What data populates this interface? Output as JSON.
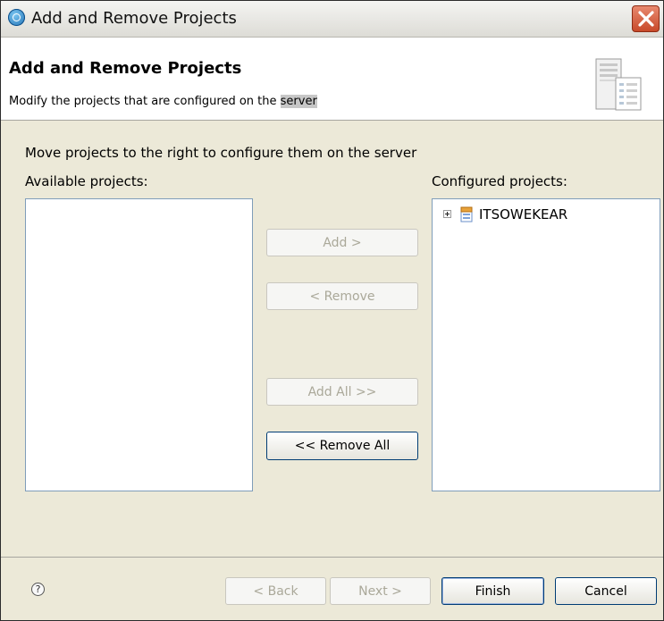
{
  "window": {
    "title": "Add and Remove Projects"
  },
  "header": {
    "title": "Add and Remove Projects",
    "description_prefix": "Modify the projects that are configured on the ",
    "description_highlight": "server"
  },
  "main": {
    "instruction": "Move projects to the right to configure them on the server",
    "available_label": "Available projects:",
    "configured_label": "Configured projects:",
    "available_items": [],
    "configured_items": [
      {
        "label": "ITSOWEKEAR",
        "expanded": false,
        "icon": "ear-project-icon"
      }
    ]
  },
  "buttons": {
    "add": {
      "label": "Add >",
      "enabled": false
    },
    "remove": {
      "label": "< Remove",
      "enabled": false
    },
    "add_all": {
      "label": "Add All >>",
      "enabled": false
    },
    "remove_all": {
      "label": "<< Remove All",
      "enabled": true
    }
  },
  "footer": {
    "help_glyph": "?",
    "back": {
      "label": "< Back",
      "enabled": false
    },
    "next": {
      "label": "Next >",
      "enabled": false
    },
    "finish": {
      "label": "Finish",
      "enabled": true
    },
    "cancel": {
      "label": "Cancel",
      "enabled": true
    }
  },
  "colors": {
    "dialog_bg": "#ece9d8",
    "button_border_enabled": "#003c74",
    "disabled_text": "#aaa899",
    "close_button": "#c84a2a"
  }
}
